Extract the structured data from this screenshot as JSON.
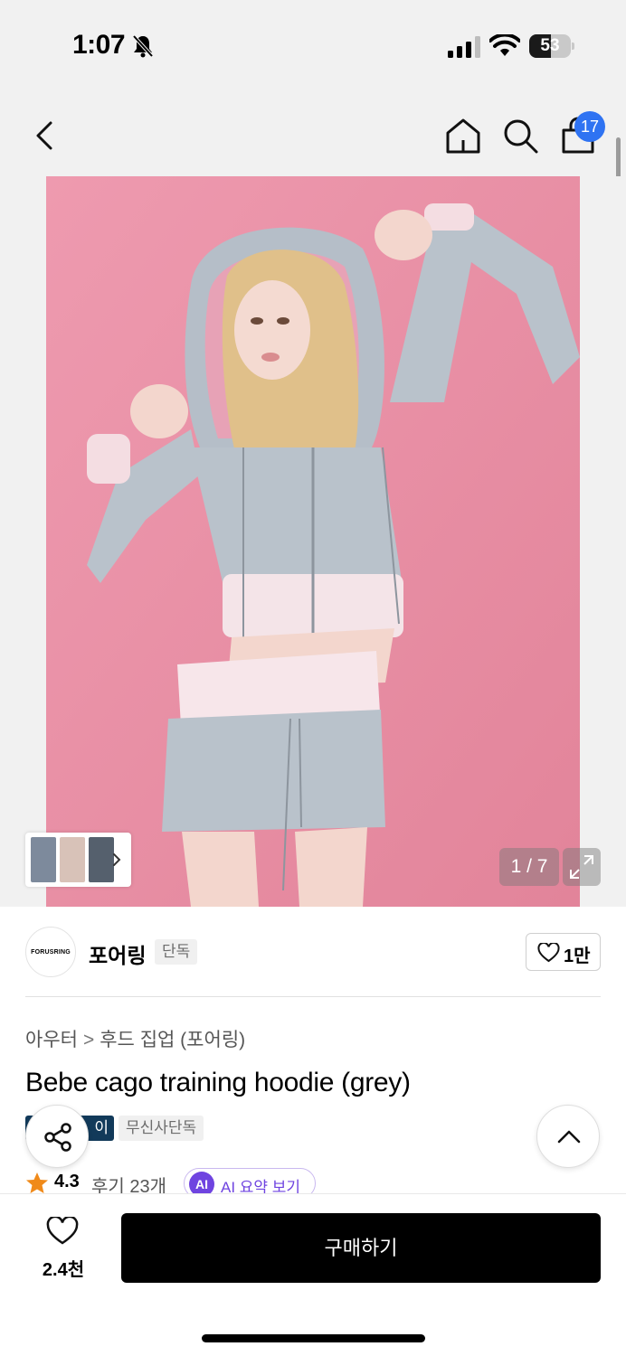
{
  "status_bar": {
    "time": "1:07",
    "battery_level": "53",
    "battery_fraction": 0.53
  },
  "header": {
    "cart_count": "17",
    "icons": [
      "chevron-left-icon",
      "home-icon",
      "search-icon",
      "shopping-bag-icon"
    ]
  },
  "gallery": {
    "pager": "1 / 7",
    "current": 1,
    "total": 7
  },
  "brand": {
    "logo_text": "FORUSRING",
    "name": "포어링",
    "tag": "단독",
    "like_count": "1만"
  },
  "product": {
    "breadcrumb": [
      "아우터",
      "후드 집업 (포어링)"
    ],
    "title": "Bebe cago training hoodie (grey)",
    "tags": [
      "이",
      "무신사단독"
    ],
    "rating": "4.3",
    "reviews_link": "후기 23개",
    "ai_badge": "AI",
    "ai_summary_label": "AI 요약 보기"
  },
  "bottom_bar": {
    "wish_count": "2.4천",
    "buy_label": "구매하기"
  },
  "colors": {
    "accent_blue": "#2f73f2",
    "ai_purple": "#6f44e0",
    "tag_navy": "#123a5a",
    "hero_pink": "#e98fa3",
    "rating_star": "#f08a1a"
  }
}
